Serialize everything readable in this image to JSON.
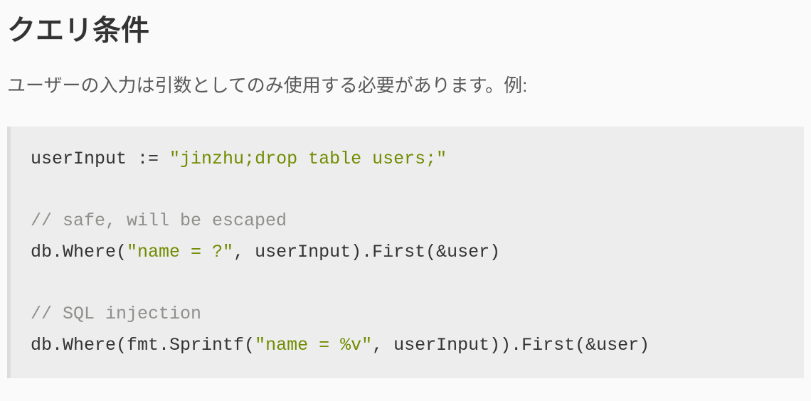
{
  "heading": "クエリ条件",
  "description": "ユーザーの入力は引数としてのみ使用する必要があります。例:",
  "code": {
    "line1": {
      "p1": "userInput := ",
      "s1": "\"jinzhu;drop table users;\""
    },
    "blank1": " ",
    "comment1": "// safe, will be escaped",
    "line2": {
      "p1": "db.Where(",
      "s1": "\"name = ?\"",
      "p2": ", userInput).First(&user)"
    },
    "blank2": " ",
    "comment2": "// SQL injection",
    "line3": {
      "p1": "db.Where(fmt.Sprintf(",
      "s1": "\"name = %v\"",
      "p2": ", userInput)).First(&user)"
    }
  }
}
